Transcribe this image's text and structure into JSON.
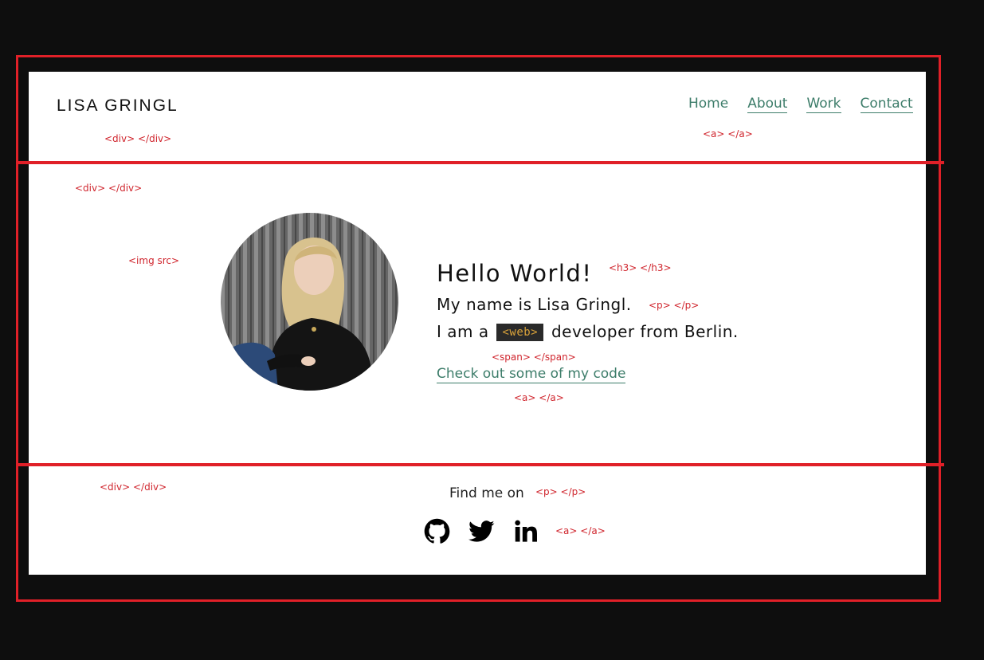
{
  "header": {
    "brand": "LISA GRINGL",
    "nav": [
      {
        "label": "Home"
      },
      {
        "label": "About"
      },
      {
        "label": "Work"
      },
      {
        "label": "Contact"
      }
    ]
  },
  "hero": {
    "title": "Hello World!",
    "intro": "My name is Lisa Gringl.",
    "role_prefix": "I am a",
    "role_tag": "<web>",
    "role_suffix": "developer from Berlin.",
    "link": "Check out some of my code"
  },
  "footer": {
    "find_text": "Find me on",
    "social": [
      {
        "icon": "github-icon"
      },
      {
        "icon": "twitter-icon"
      },
      {
        "icon": "linkedin-icon"
      }
    ]
  },
  "annotations": {
    "header_div": "<div> </div>",
    "nav_a": "<a> </a>",
    "hero_div": "<div> </div>",
    "img": "<img src>",
    "h3": "<h3> </h3>",
    "p1": "<p> </p>",
    "span": "<span> </span>",
    "a_link": "<a> </a>",
    "footer_div": "<div> </div>",
    "footer_p": "<p> </p>",
    "footer_a": "<a> </a>"
  },
  "colors": {
    "accent": "#3d7d6a",
    "annotation_red": "#e02028",
    "tag_bg": "#2a2a2a",
    "tag_text": "#d8a23a"
  }
}
